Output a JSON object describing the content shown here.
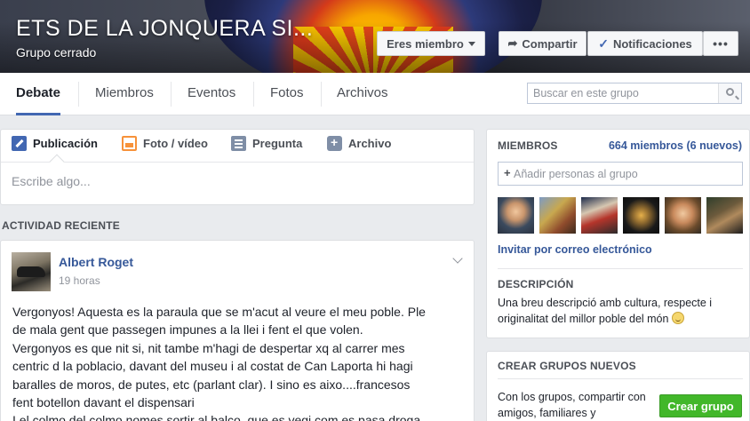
{
  "group": {
    "title": "ETS DE LA JONQUERA SI...",
    "privacy": "Grupo cerrado"
  },
  "header_buttons": {
    "member": "Eres miembro",
    "share": "Compartir",
    "notifications": "Notificaciones",
    "more": "•••"
  },
  "nav": {
    "tabs": [
      "Debate",
      "Miembros",
      "Eventos",
      "Fotos",
      "Archivos"
    ],
    "active": "Debate",
    "search_placeholder": "Buscar en este grupo"
  },
  "composer": {
    "tabs": [
      "Publicación",
      "Foto / vídeo",
      "Pregunta",
      "Archivo"
    ],
    "placeholder": "Escribe algo..."
  },
  "feed": {
    "section_title": "ACTIVIDAD RECIENTE",
    "post": {
      "author": "Albert Roget",
      "time": "19 horas",
      "lines": [
        "Vergonyos! Aquesta es la paraula que se m'acut al veure el meu poble. Ple",
        "de mala gent que passegen impunes a la llei i fent el que volen.",
        "Vergonyos es que nit si, nit tambe m'hagi de despertar xq al carrer mes",
        "centric d la poblacio, davant del museu i al costat de Can Laporta hi hagi",
        "baralles de moros, de putes, etc (parlant clar). I sino es aixo....francesos",
        "fent botellon davant el dispensari",
        "I el colmo del colmo nomes sortir al balco, que es vegi com es pasa droga"
      ]
    }
  },
  "members_panel": {
    "label": "MIEMBROS",
    "count": "664 miembros (6 nuevos)",
    "add_placeholder": "Añadir personas al grupo",
    "invite": "Invitar por correo electrónico",
    "description_label": "DESCRIPCIÓN",
    "description": "Una breu descripció amb cultura, respecte i originalitat del millor poble del món"
  },
  "create_panel": {
    "label": "CREAR GRUPOS NUEVOS",
    "text": "Con los grupos, compartir con amigos, familiares y",
    "button": "Crear grupo"
  },
  "colors": {
    "link": "#365899",
    "accent": "#4267b2",
    "create_button": "#42b72a"
  }
}
